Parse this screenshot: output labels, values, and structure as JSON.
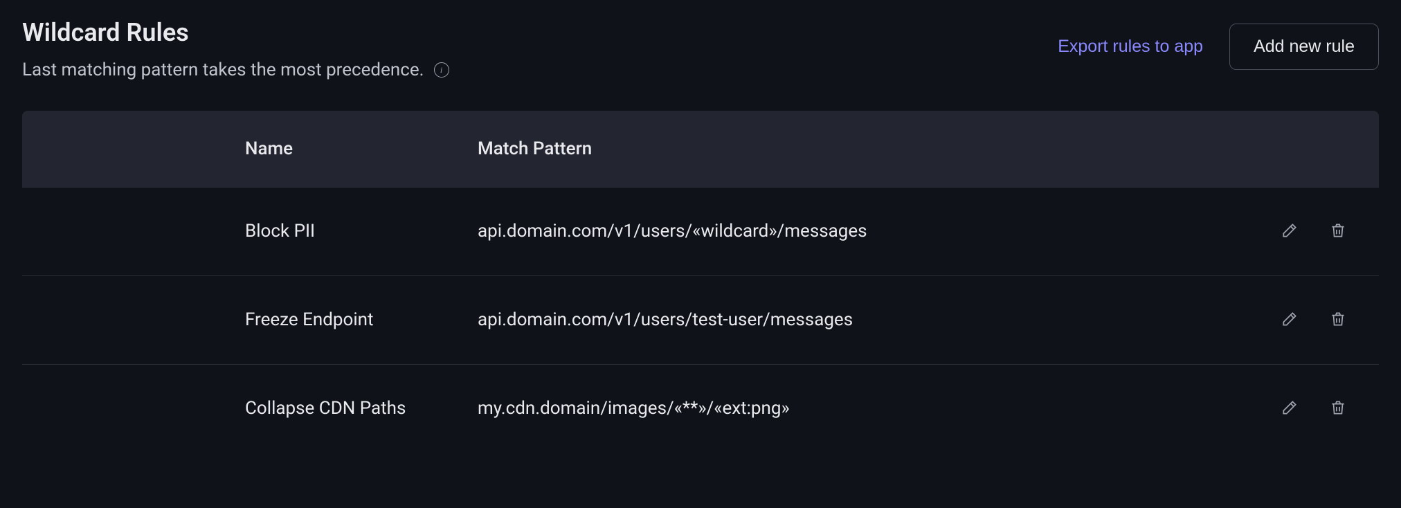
{
  "header": {
    "title": "Wildcard Rules",
    "subtitle": "Last matching pattern takes the most precedence.",
    "export_label": "Export rules to app",
    "add_label": "Add new rule"
  },
  "table": {
    "columns": {
      "name": "Name",
      "pattern": "Match Pattern"
    },
    "rows": [
      {
        "name": "Block PII",
        "pattern": "api.domain.com/v1/users/«wildcard»/messages"
      },
      {
        "name": "Freeze Endpoint",
        "pattern": "api.domain.com/v1/users/test-user/messages"
      },
      {
        "name": "Collapse CDN Paths",
        "pattern": "my.cdn.domain/images/«**»/«ext:png»"
      }
    ]
  },
  "icons": {
    "info": "info-icon",
    "edit": "pencil-icon",
    "delete": "trash-icon"
  }
}
